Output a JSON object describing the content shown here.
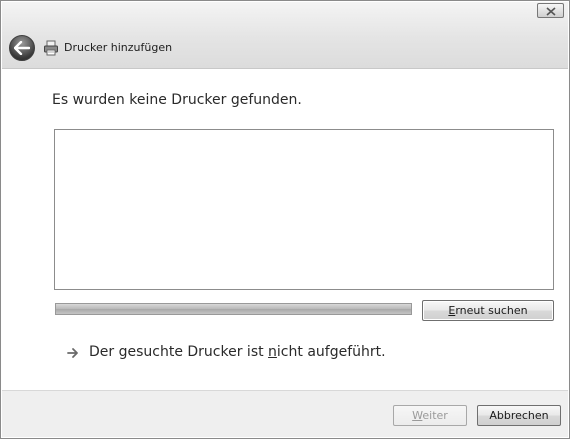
{
  "window": {
    "title": "Drucker hinzufügen",
    "close_icon": "close-icon",
    "back_icon": "back-arrow-icon",
    "title_icon": "printer-icon"
  },
  "main": {
    "heading": "Es wurden keine Drucker gefunden.",
    "printer_list": [],
    "search_progress": 1.0,
    "rescan_button": {
      "mnemonic": "E",
      "rest": "rneut suchen"
    },
    "not_listed_link": {
      "icon": "arrow-right-icon",
      "before": "Der gesuchte Drucker ist ",
      "mnemonic": "n",
      "after": "icht aufgeführt."
    }
  },
  "footer": {
    "next_button": {
      "mnemonic": "W",
      "rest": "eiter",
      "enabled": false
    },
    "cancel_button": "Abbrechen"
  }
}
